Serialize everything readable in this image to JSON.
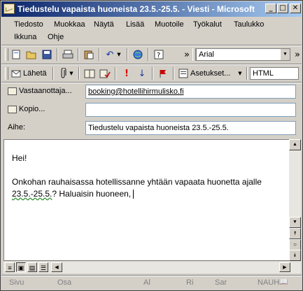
{
  "window": {
    "title": "Tiedustelu vapaista huoneista 23.5.-25.5. - Viesti - Microsoft ..."
  },
  "title_buttons": {
    "minimize": "_",
    "maximize": "□",
    "close": "✕"
  },
  "menu": {
    "row1": [
      "Tiedosto",
      "Muokkaa",
      "Näytä",
      "Lisää",
      "Muotoile",
      "Työkalut",
      "Taulukko"
    ],
    "row2": [
      "Ikkuna",
      "Ohje"
    ]
  },
  "toolbar1": {
    "font": "Arial",
    "overflow": "»"
  },
  "toolbar2": {
    "send_label": "Lähetä",
    "options_label": "Asetukset...",
    "format": "HTML",
    "overflow": "»"
  },
  "fields": {
    "to_label": "Vastaanottaja...",
    "to_value": "booking@hotellihirmulisko.fi",
    "cc_label": "Kopio...",
    "cc_value": "",
    "subject_label": "Aihe:",
    "subject_value": "Tiedustelu vapaista huoneista 23.5.-25.5."
  },
  "body": {
    "greeting": "Hei!",
    "line1": "Onkohan rauhaisassa hotellissanne yhtään vapaata huonetta ajalle",
    "line2_date": "23.5.-25.5.",
    "line2_rest": "? Haluaisin huoneen, "
  },
  "status": {
    "page": "Sivu",
    "section": "Osa",
    "at": "Al",
    "line": "Ri",
    "col": "Sar",
    "ovr": "NAUH"
  },
  "icons": {
    "new": "new-document-icon",
    "open": "open-folder-icon",
    "save": "save-icon",
    "print": "print-icon",
    "paste": "paste-icon",
    "undo": "undo-icon",
    "globe": "web-icon",
    "help": "help-icon",
    "send": "send-icon",
    "attach": "paperclip-icon",
    "address_book": "address-book-icon",
    "check_names": "check-names-icon",
    "importance_high": "high-importance-icon",
    "importance_low": "low-importance-icon",
    "flag": "flag-icon"
  }
}
